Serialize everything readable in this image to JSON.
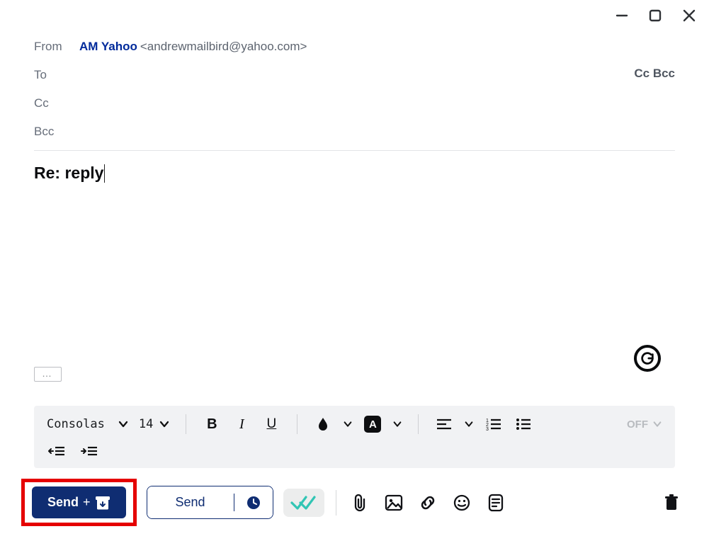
{
  "window": {
    "minimize": "minimize",
    "maximize": "maximize",
    "close": "close"
  },
  "header": {
    "from_label": "From",
    "from_name": "AM Yahoo",
    "from_email": "<andrewmailbird@yahoo.com>",
    "to_label": "To",
    "cc_label": "Cc",
    "bcc_label": "Bcc",
    "cc_toggle": "Cc",
    "bcc_toggle": "Bcc"
  },
  "subject": "Re: reply",
  "more_dots": "…",
  "format_bar": {
    "font_name": "Consolas",
    "font_size": "14",
    "off_label": "OFF"
  },
  "actions": {
    "send_archive_label": "Send",
    "send_archive_plus": "+",
    "send_label": "Send"
  },
  "icons": {
    "bold": "B",
    "italic": "I",
    "underline": "U",
    "text_bg": "A"
  }
}
